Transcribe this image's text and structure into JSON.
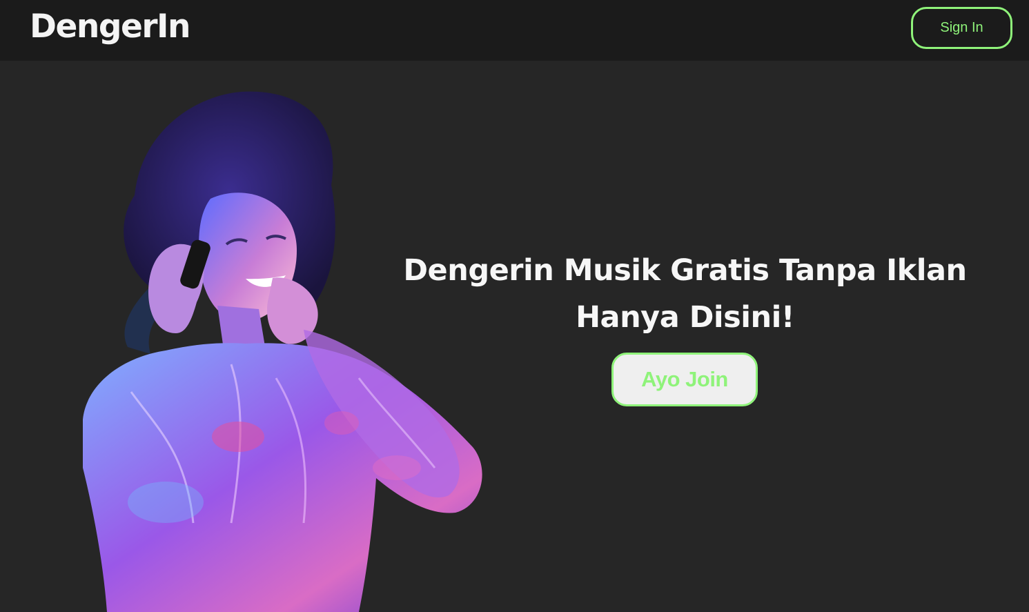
{
  "header": {
    "logo_text": "DengerIn",
    "signin_label": "Sign In"
  },
  "hero": {
    "headline_line1": "Dengerin Musik Gratis Tanpa Iklan",
    "headline_line2": "Hanya Disini!",
    "cta_label": "Ayo Join",
    "image": "woman-with-headphones"
  },
  "colors": {
    "accent": "#8ff37a",
    "navbar_bg": "#1b1b1b",
    "page_bg": "#262626",
    "text": "#f7f7f7"
  }
}
